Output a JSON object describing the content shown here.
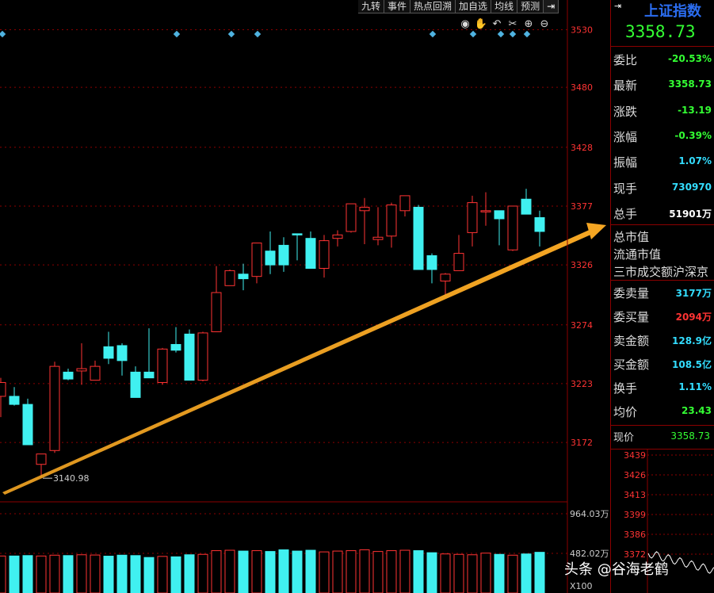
{
  "toolbar": {
    "buttons": [
      "九转",
      "事件",
      "热点回溯",
      "加自选",
      "均线",
      "预测"
    ],
    "icons": [
      "eye-icon",
      "hand-icon",
      "undo-icon",
      "scissors-icon",
      "zoom-in-icon",
      "zoom-out-icon"
    ]
  },
  "chart_data": {
    "type": "candlestick",
    "price_axis_ticks": [
      "3530",
      "3480",
      "3428",
      "3377",
      "3326",
      "3274",
      "3223",
      "3172"
    ],
    "ylim": [
      3126,
      3542
    ],
    "volume_axis_ticks": [
      "964.03万",
      "482.02万"
    ],
    "volume_unit_label": "X100",
    "low_annotation": "3140.98",
    "candles": [
      {
        "o": 3212,
        "h": 3228,
        "l": 3194,
        "c": 3224
      },
      {
        "o": 3212,
        "h": 3220,
        "l": 3204,
        "c": 3205
      },
      {
        "o": 3205,
        "h": 3210,
        "l": 3170,
        "c": 3170
      },
      {
        "o": 3153,
        "h": 3159,
        "l": 3141,
        "c": 3162
      },
      {
        "o": 3165,
        "h": 3242,
        "l": 3163,
        "c": 3238
      },
      {
        "o": 3233,
        "h": 3236,
        "l": 3226,
        "c": 3227
      },
      {
        "o": 3234,
        "h": 3258,
        "l": 3222,
        "c": 3236
      },
      {
        "o": 3226,
        "h": 3243,
        "l": 3226,
        "c": 3238
      },
      {
        "o": 3255,
        "h": 3268,
        "l": 3240,
        "c": 3245
      },
      {
        "o": 3256,
        "h": 3258,
        "l": 3230,
        "c": 3243
      },
      {
        "o": 3233,
        "h": 3238,
        "l": 3212,
        "c": 3211
      },
      {
        "o": 3233,
        "h": 3271,
        "l": 3232,
        "c": 3228
      },
      {
        "o": 3224,
        "h": 3254,
        "l": 3222,
        "c": 3253
      },
      {
        "o": 3257,
        "h": 3272,
        "l": 3250,
        "c": 3252
      },
      {
        "o": 3266,
        "h": 3270,
        "l": 3226,
        "c": 3226
      },
      {
        "o": 3226,
        "h": 3268,
        "l": 3225,
        "c": 3267
      },
      {
        "o": 3268,
        "h": 3325,
        "l": 3268,
        "c": 3302
      },
      {
        "o": 3308,
        "h": 3322,
        "l": 3308,
        "c": 3321
      },
      {
        "o": 3318,
        "h": 3327,
        "l": 3304,
        "c": 3314
      },
      {
        "o": 3316,
        "h": 3345,
        "l": 3310,
        "c": 3345
      },
      {
        "o": 3338,
        "h": 3355,
        "l": 3318,
        "c": 3326
      },
      {
        "o": 3343,
        "h": 3350,
        "l": 3320,
        "c": 3326
      },
      {
        "o": 3353,
        "h": 3352,
        "l": 3330,
        "c": 3352
      },
      {
        "o": 3349,
        "h": 3355,
        "l": 3324,
        "c": 3323
      },
      {
        "o": 3323,
        "h": 3352,
        "l": 3315,
        "c": 3347
      },
      {
        "o": 3349,
        "h": 3356,
        "l": 3342,
        "c": 3352
      },
      {
        "o": 3355,
        "h": 3377,
        "l": 3354,
        "c": 3379
      },
      {
        "o": 3373,
        "h": 3384,
        "l": 3344,
        "c": 3376
      },
      {
        "o": 3348,
        "h": 3376,
        "l": 3343,
        "c": 3350
      },
      {
        "o": 3351,
        "h": 3380,
        "l": 3341,
        "c": 3378
      },
      {
        "o": 3373,
        "h": 3385,
        "l": 3368,
        "c": 3386
      },
      {
        "o": 3376,
        "h": 3378,
        "l": 3322,
        "c": 3322
      },
      {
        "o": 3334,
        "h": 3336,
        "l": 3310,
        "c": 3322
      },
      {
        "o": 3312,
        "h": 3319,
        "l": 3298,
        "c": 3318
      },
      {
        "o": 3321,
        "h": 3352,
        "l": 3329,
        "c": 3336
      },
      {
        "o": 3354,
        "h": 3386,
        "l": 3342,
        "c": 3380
      },
      {
        "o": 3373,
        "h": 3389,
        "l": 3360,
        "c": 3373
      },
      {
        "o": 3373,
        "h": 3373,
        "l": 3343,
        "c": 3366
      },
      {
        "o": 3339,
        "h": 3377,
        "l": 3338,
        "c": 3377
      },
      {
        "o": 3383,
        "h": 3392,
        "l": 3370,
        "c": 3370
      },
      {
        "o": 3367,
        "h": 3373,
        "l": 3342,
        "c": 3355
      }
    ],
    "volumes": [
      450,
      450,
      455,
      450,
      460,
      455,
      465,
      462,
      448,
      460,
      455,
      432,
      445,
      440,
      465,
      470,
      515,
      520,
      510,
      515,
      505,
      525,
      510,
      520,
      500,
      510,
      515,
      525,
      505,
      515,
      520,
      515,
      490,
      475,
      470,
      465,
      485,
      470,
      460,
      475,
      495
    ]
  },
  "panel": {
    "index_name": "上证指数",
    "price": "3358.73",
    "rows": [
      {
        "label": "委比",
        "value": "-20.53%",
        "tone": "green"
      },
      {
        "label": "最新",
        "value": "3358.73",
        "tone": "green"
      },
      {
        "label": "涨跌",
        "value": "-13.19",
        "tone": "green"
      },
      {
        "label": "涨幅",
        "value": "-0.39%",
        "tone": "green"
      },
      {
        "label": "振幅",
        "value": "1.07%",
        "tone": "cyan"
      },
      {
        "label": "现手",
        "value": "730970",
        "tone": "cyan"
      },
      {
        "label": "总手",
        "value": "51901万",
        "tone": "white"
      }
    ],
    "market_rows": [
      "总市值",
      "流通市值",
      "三市成交额沪深京"
    ],
    "order_rows": [
      {
        "label": "委卖量",
        "value": "3177万",
        "tone": "cyan"
      },
      {
        "label": "委买量",
        "value": "2094万",
        "tone": "red"
      },
      {
        "label": "卖金额",
        "value": "128.9亿",
        "tone": "cyan"
      },
      {
        "label": "买金额",
        "value": "108.5亿",
        "tone": "cyan"
      },
      {
        "label": "换手",
        "value": "1.11%",
        "tone": "cyan"
      },
      {
        "label": "均价",
        "value": "23.43",
        "tone": "green"
      }
    ],
    "current_label": "现价",
    "current_value": "3358.73",
    "mini_axis": [
      "3439",
      "3426",
      "3413",
      "3399",
      "3386",
      "3372"
    ]
  },
  "watermark": "头条 @谷海老鹤",
  "colors": {
    "up": "#ff3333",
    "down": "#40f0f0",
    "grid": "#8b0000",
    "arrow": "#f5a623",
    "marker": "#4fb3e0"
  }
}
